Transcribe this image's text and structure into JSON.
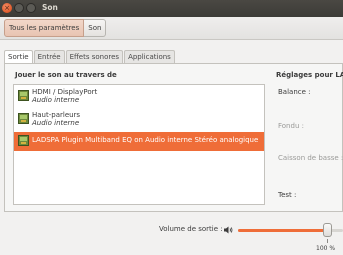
{
  "window": {
    "title": "Son"
  },
  "toolbar": {
    "crumbs": [
      "Tous les paramètres",
      "Son"
    ]
  },
  "tabs": [
    "Sortie",
    "Entrée",
    "Effets sonores",
    "Applications"
  ],
  "output": {
    "list_heading": "Jouer le son au travers de",
    "devices": [
      {
        "name": "HDMI / DisplayPort",
        "sub": "Audio interne"
      },
      {
        "name": "Haut-parleurs",
        "sub": "Audio interne"
      },
      {
        "name": "LADSPA Plugin Multiband EQ on Audio interne Stéréo analogique",
        "sub": ""
      }
    ],
    "selected_index": 2,
    "settings_heading": "Réglages pour LADS",
    "balance_label": "Balance :",
    "fade_label": "Fondu :",
    "bass_label": "Caisson de basse :",
    "test_label": "Test :"
  },
  "volume": {
    "label": "Volume de sortie :",
    "value_percent": 85,
    "percent_label": "100 %"
  },
  "colors": {
    "accent": "#ef6d38",
    "titlebar": "#3c3b37"
  },
  "icons": {
    "close": "close-icon",
    "speaker": "speaker-icon",
    "device": "sound-card-icon"
  }
}
